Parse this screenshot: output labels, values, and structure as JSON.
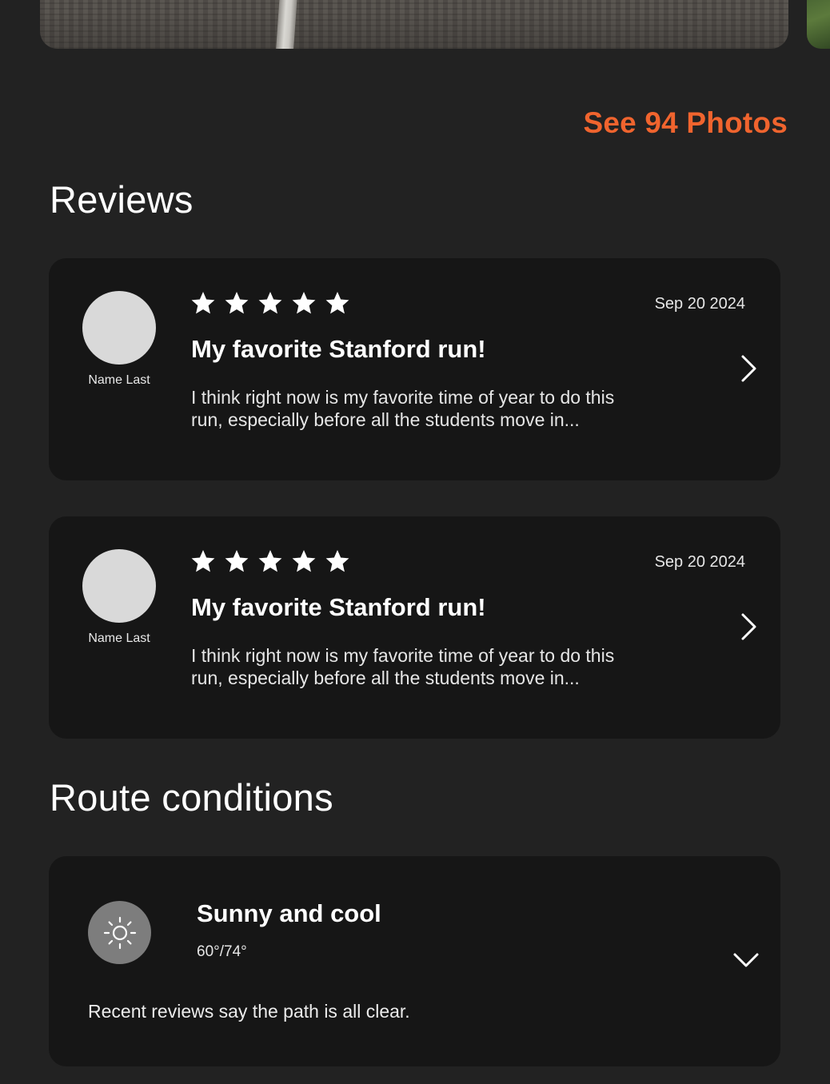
{
  "photos": {
    "see_all_label": "See 94 Photos"
  },
  "reviews": {
    "heading": "Reviews",
    "items": [
      {
        "author": "Name Last",
        "rating": 5,
        "date": "Sep 20 2024",
        "title": "My favorite Stanford run!",
        "body": "I think right now is my favorite time of year to do this run, especially before all the students move in..."
      },
      {
        "author": "Name Last",
        "rating": 5,
        "date": "Sep 20 2024",
        "title": "My favorite Stanford run!",
        "body": "I think right now is my favorite time of year to do this run, especially before all the students move in..."
      }
    ]
  },
  "conditions": {
    "heading": "Route conditions",
    "weather_icon": "sun-icon",
    "summary": "Sunny and cool",
    "temperature": "60°/74°",
    "note": "Recent reviews say the path is all clear."
  },
  "colors": {
    "accent": "#f0642e",
    "background": "#222222",
    "card": "#161616",
    "avatar": "#d9d9d9"
  }
}
